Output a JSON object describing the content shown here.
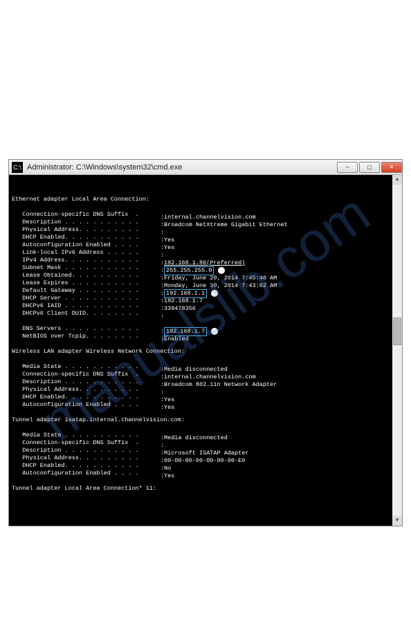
{
  "watermark": "manualslib.com",
  "window": {
    "title": "Administrator: C:\\Windows\\system32\\cmd.exe",
    "icon_label": "C:\\"
  },
  "sections": [
    {
      "header": "Ethernet adapter Local Area Connection:",
      "lines": [
        {
          "label": "Connection-specific DNS Suffix  .",
          "value": "internal.channelvision.com"
        },
        {
          "label": "Description . . . . . . . . . . .",
          "value": "Broadcom NetXtreme Gigabit Ethernet"
        },
        {
          "label": "Physical Address. . . . . . . . .",
          "value": ""
        },
        {
          "label": "DHCP Enabled. . . . . . . . . . .",
          "value": "Yes"
        },
        {
          "label": "Autoconfiguration Enabled . . . .",
          "value": "Yes"
        },
        {
          "label": "Link-local IPv6 Address . . . . .",
          "value": ""
        },
        {
          "label": "IPv4 Address. . . . . . . . . . .",
          "value": "192.168.1.86(Preferred)",
          "underline": true
        },
        {
          "label": "Subnet Mask . . . . . . . . . . .",
          "value": "255.255.255.0",
          "boxed": true,
          "dot": true
        },
        {
          "label": "Lease Obtained. . . . . . . . . .",
          "value": "Friday, June 20, 2014 7:45:40 AM"
        },
        {
          "label": "Lease Expires . . . . . . . . . .",
          "value": "Monday, June 30, 2014 7:43:02 AM"
        },
        {
          "label": "Default Gateway . . . . . . . . .",
          "value": "192.168.1.1",
          "boxed": true,
          "dot": true
        },
        {
          "label": "DHCP Server . . . . . . . . . . .",
          "value": "192.168.1.7"
        },
        {
          "label": "DHCPv6 IAID . . . . . . . . . . .",
          "value": "339478356"
        },
        {
          "label": "DHCPv6 Client DUID. . . . . . . .",
          "value": ""
        },
        {
          "label": "",
          "value": ""
        },
        {
          "label": "DNS Servers . . . . . . . . . . .",
          "value": "192.168.1.7",
          "boxed": true,
          "dot": true
        },
        {
          "label": "NetBIOS over Tcpip. . . . . . . .",
          "value": "Enabled"
        }
      ]
    },
    {
      "header": "Wireless LAN adapter Wireless Network Connection:",
      "lines": [
        {
          "label": "Media State . . . . . . . . . . .",
          "value": "Media disconnected"
        },
        {
          "label": "Connection-specific DNS Suffix  .",
          "value": "internal.channelvision.com"
        },
        {
          "label": "Description . . . . . . . . . . .",
          "value": "Broadcom 802.11n Network Adapter"
        },
        {
          "label": "Physical Address. . . . . . . . .",
          "value": ""
        },
        {
          "label": "DHCP Enabled. . . . . . . . . . .",
          "value": "Yes"
        },
        {
          "label": "Autoconfiguration Enabled . . . .",
          "value": "Yes"
        }
      ]
    },
    {
      "header": "Tunnel adapter isatap.internal.channelvision.com:",
      "lines": [
        {
          "label": "Media State . . . . . . . . . . .",
          "value": "Media disconnected"
        },
        {
          "label": "Connection-specific DNS Suffix  .",
          "value": ""
        },
        {
          "label": "Description . . . . . . . . . . .",
          "value": "Microsoft ISATAP Adapter"
        },
        {
          "label": "Physical Address. . . . . . . . .",
          "value": "00-00-00-00-00-00-00-E0"
        },
        {
          "label": "DHCP Enabled. . . . . . . . . . .",
          "value": "No"
        },
        {
          "label": "Autoconfiguration Enabled . . . .",
          "value": "Yes"
        }
      ]
    },
    {
      "header": "Tunnel adapter Local Area Connection* 11:",
      "lines": []
    }
  ]
}
